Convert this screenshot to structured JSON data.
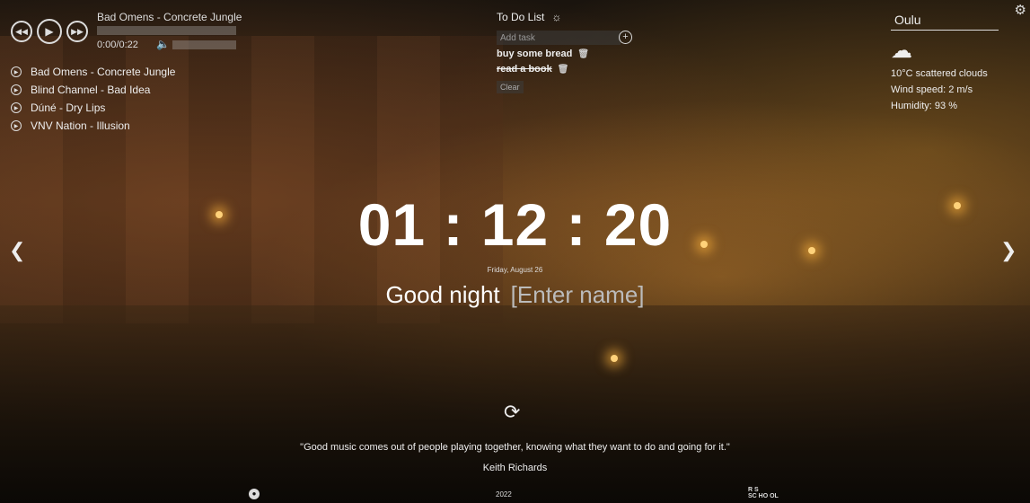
{
  "player": {
    "track_title": "Bad Omens - Concrete Jungle",
    "time": "0:00/0:22",
    "progress": 0,
    "prev_icon": "rewind-icon",
    "play_icon": "play-icon",
    "next_icon": "fast-forward-icon",
    "volume_icon": "speaker-icon",
    "playlist": [
      {
        "label": "Bad Omens - Concrete Jungle"
      },
      {
        "label": "Blind Channel - Bad Idea"
      },
      {
        "label": "Dúné - Dry Lips"
      },
      {
        "label": "VNV Nation - Illusion"
      }
    ]
  },
  "todo": {
    "title": "To Do List",
    "input_placeholder": "Add task",
    "items": [
      {
        "label": "buy some bread",
        "done": false
      },
      {
        "label": "read a book",
        "done": true
      }
    ],
    "clear_label": "Clear"
  },
  "weather": {
    "city": "Oulu",
    "icon": "cloud-icon",
    "temp_desc": "10°C   scattered clouds",
    "wind": "Wind speed: 2 m/s",
    "humidity": "Humidity: 93 %"
  },
  "clock": {
    "time": "01 : 12 : 20",
    "date": "Friday, August 26"
  },
  "greeting": {
    "text": "Good night",
    "name_placeholder": "[Enter name]"
  },
  "quote": {
    "text": "\"Good music comes out of people playing together, knowing what they want to do and going for it.\"",
    "author": "Keith Richards"
  },
  "footer": {
    "year": "2022",
    "rss_line1": "R  S",
    "rss_line2": "SC HO OL"
  }
}
